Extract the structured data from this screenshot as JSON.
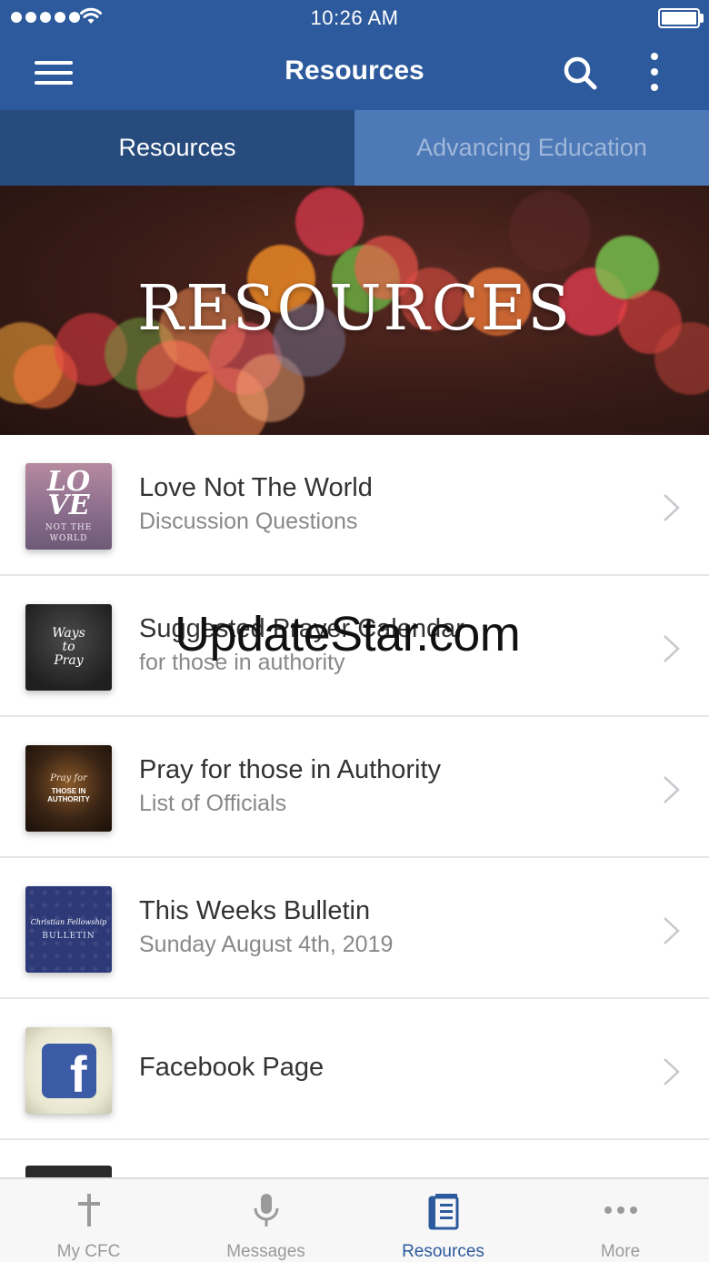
{
  "status_bar": {
    "time": "10:26 AM",
    "signal_dots": 5
  },
  "nav_bar": {
    "title": "Resources",
    "menu_icon": "hamburger-menu-icon",
    "search_icon": "search-icon",
    "more_icon": "vertical-dots-icon"
  },
  "tabs": [
    {
      "label": "Resources",
      "active": true
    },
    {
      "label": "Advancing Education",
      "active": false
    }
  ],
  "hero": {
    "title": "RESOURCES"
  },
  "list": [
    {
      "title": "Love Not The World",
      "subtitle": "Discussion Questions",
      "thumb": {
        "line1": "LO",
        "line2": "VE",
        "line3": "NOT THE",
        "line4": "WORLD"
      }
    },
    {
      "title": "Suggested Prayer Calendar",
      "subtitle": "for those in authority",
      "thumb": {
        "line1": "Ways",
        "line2": "to",
        "line3": "Pray"
      }
    },
    {
      "title": "Pray for those in Authority",
      "subtitle": "List of Officials",
      "thumb": {
        "line1": "Pray for",
        "line2": "THOSE IN",
        "line3": "AUTHORITY"
      }
    },
    {
      "title": "This Weeks Bulletin",
      "subtitle": "Sunday August 4th, 2019",
      "thumb": {
        "line1": "Christian Fellowship",
        "line2": "BULLETIN"
      }
    },
    {
      "title": "Facebook Page",
      "subtitle": "",
      "thumb": {
        "line1": "f"
      }
    }
  ],
  "watermark": "UpdateStar.com",
  "tab_bar": [
    {
      "label": "My CFC",
      "icon": "cross-icon",
      "active": false
    },
    {
      "label": "Messages",
      "icon": "microphone-icon",
      "active": false
    },
    {
      "label": "Resources",
      "icon": "book-icon",
      "active": true
    },
    {
      "label": "More",
      "icon": "horizontal-dots-icon",
      "active": false
    }
  ],
  "colors": {
    "brand": "#2d5a9c",
    "tab_active_bg": "#284b7e",
    "tab_inactive_bg": "#4e79b7",
    "active_tab_label": "#2d5a9c"
  }
}
